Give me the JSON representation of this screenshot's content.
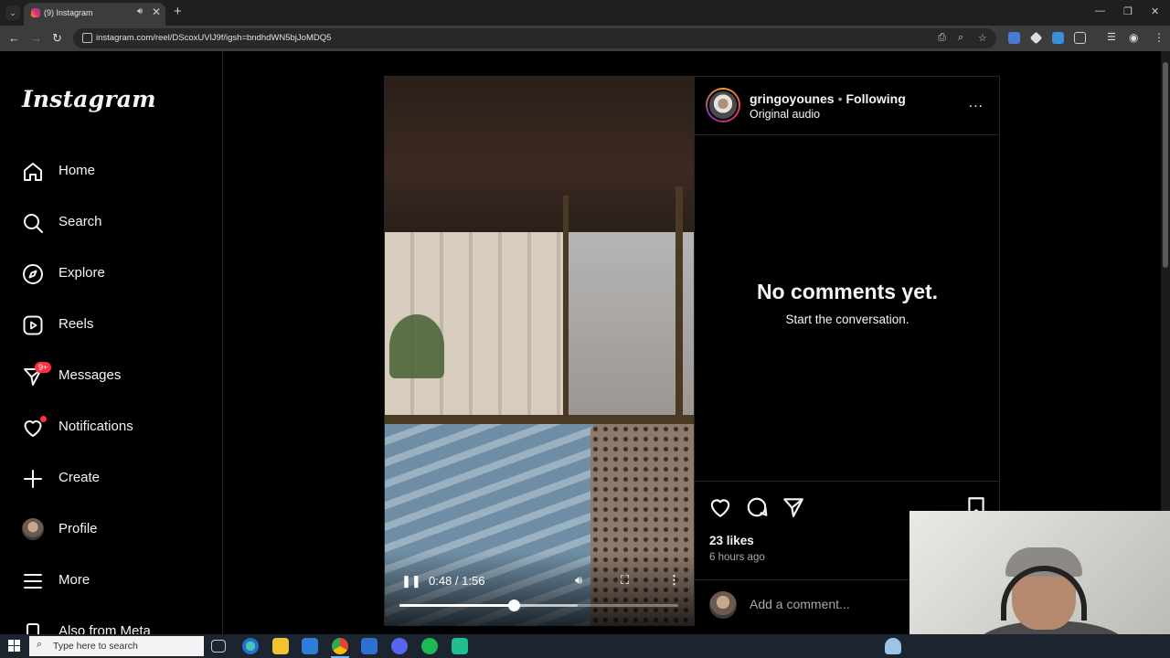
{
  "browser": {
    "tab_title": "(9) Instagram",
    "url": "instagram.com/reel/DScoxUVlJ9f/igsh=bndhdWN5bjJoMDQ5"
  },
  "sidebar": {
    "logo": "Instagram",
    "items": [
      {
        "label": "Home",
        "icon": "home-icon"
      },
      {
        "label": "Search",
        "icon": "search-icon"
      },
      {
        "label": "Explore",
        "icon": "compass-icon"
      },
      {
        "label": "Reels",
        "icon": "reels-icon"
      },
      {
        "label": "Messages",
        "icon": "messenger-icon",
        "badge": "9+"
      },
      {
        "label": "Notifications",
        "icon": "heart-icon"
      },
      {
        "label": "Create",
        "icon": "plus-icon"
      },
      {
        "label": "Profile",
        "icon": "avatar"
      },
      {
        "label": "More",
        "icon": "hamburger-icon"
      },
      {
        "label": "Also from Meta",
        "icon": "meta-icon"
      }
    ]
  },
  "video": {
    "time": "0:48 / 1:56",
    "progress": 0.41,
    "buffered": 0.64
  },
  "post": {
    "username": "gringoyounes",
    "separator": "•",
    "follow_status": "Following",
    "audio": "Original audio",
    "more": "...",
    "empty_title": "No comments yet.",
    "empty_subtitle": "Start the conversation.",
    "likes": "23 likes",
    "time_ago": "6 hours ago",
    "comment_placeholder": "Add a comment..."
  },
  "taskbar": {
    "search_placeholder": "Type here to search"
  },
  "colors": {
    "notification_red": "#ff3040",
    "background": "#000000",
    "border": "#262626"
  }
}
